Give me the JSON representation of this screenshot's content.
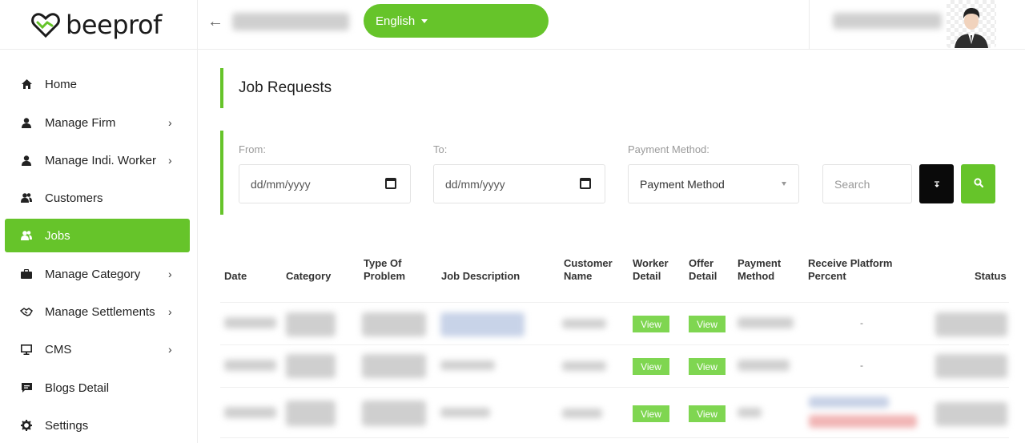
{
  "brand": {
    "name": "beeprof",
    "color": "#66c42a"
  },
  "header": {
    "language": "English"
  },
  "sidebar": {
    "items": [
      {
        "label": "Home",
        "icon": "home-icon"
      },
      {
        "label": "Manage Firm",
        "icon": "user-icon",
        "has_submenu": true
      },
      {
        "label": "Manage Indi. Worker",
        "icon": "user-icon",
        "has_submenu": true
      },
      {
        "label": "Customers",
        "icon": "users-icon"
      },
      {
        "label": "Jobs",
        "icon": "users-icon",
        "active": true
      },
      {
        "label": "Manage Category",
        "icon": "briefcase-icon",
        "has_submenu": true
      },
      {
        "label": "Manage Settlements",
        "icon": "handshake-icon",
        "has_submenu": true
      },
      {
        "label": "CMS",
        "icon": "monitor-icon",
        "has_submenu": true
      },
      {
        "label": "Blogs Detail",
        "icon": "comment-icon"
      },
      {
        "label": "Settings",
        "icon": "gear-icon"
      }
    ]
  },
  "page": {
    "title": "Job Requests"
  },
  "filters": {
    "from_label": "From:",
    "from_placeholder": "dd/mm/yyyy",
    "to_label": "To:",
    "to_placeholder": "dd/mm/yyyy",
    "payment_label": "Payment Method:",
    "payment_value": "Payment Method",
    "search_placeholder": "Search"
  },
  "table": {
    "headers": {
      "date": "Date",
      "category": "Category",
      "type_of_problem": [
        "Type Of",
        "Problem"
      ],
      "job_description": "Job Description",
      "customer_name": [
        "Customer",
        "Name"
      ],
      "worker_detail": [
        "Worker",
        "Detail"
      ],
      "offer_detail": [
        "Offer",
        "Detail"
      ],
      "payment_method": [
        "Payment",
        "Method"
      ],
      "receive_platform_percent": [
        "Receive Platform",
        "Percent"
      ],
      "status": "Status"
    },
    "view_label": "View",
    "rows": [
      {
        "receive_platform_percent": "-"
      },
      {
        "receive_platform_percent": "-"
      },
      {
        "receive_platform_percent": ""
      }
    ]
  }
}
